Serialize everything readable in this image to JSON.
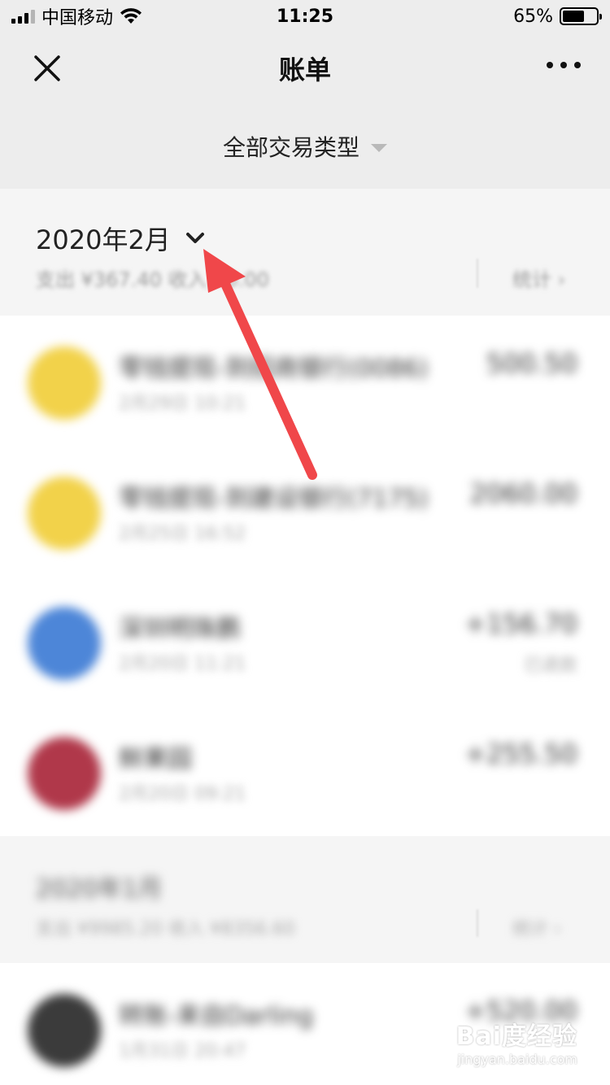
{
  "status_bar": {
    "carrier": "中国移动",
    "time": "11:25",
    "battery_percent": "65%",
    "battery_level": 0.65,
    "wifi_icon": "wifi-icon",
    "signal_icon": "signal-icon"
  },
  "nav": {
    "title": "账单",
    "close_icon": "close-icon",
    "more_icon": "more-icon"
  },
  "filter": {
    "label": "全部交易类型"
  },
  "month": {
    "label": "2020年2月",
    "summary": "支出 ¥367.40 收入 ¥0.00",
    "stats_label": "统计 ›"
  },
  "transactions": [
    {
      "title": "零钱提现-到招商银行(0086)",
      "time": "2月29日 10:21",
      "amount": "500.50",
      "note": "",
      "color": "#f2d24a"
    },
    {
      "title": "零钱提现-到建设银行(7175)",
      "time": "2月25日 16:52",
      "amount": "2060.00",
      "note": "",
      "color": "#f2d24a"
    },
    {
      "title": "深圳明珠鹏",
      "time": "2月20日 11:21",
      "amount": "+156.70",
      "note": "已退款",
      "color": "#4d86d8"
    },
    {
      "title": "鲜果园",
      "time": "2月20日 09:21",
      "amount": "+255.50",
      "note": "",
      "color": "#b0384a"
    }
  ],
  "month2": {
    "label": "2020年1月",
    "summary": "支出 ¥9985.20 收入 ¥8356.60",
    "stats_label": "统计 ›"
  },
  "transactions2": [
    {
      "title": "转账-来自Darling",
      "time": "1月31日 20:47",
      "amount": "+520.00",
      "note": "",
      "color": "#3b3b3b"
    }
  ],
  "watermark": {
    "main": "Bai度经验",
    "sub": "jingyan.baidu.com"
  },
  "colors": {
    "accent_arrow": "#f0474a",
    "background": "#ededed"
  }
}
